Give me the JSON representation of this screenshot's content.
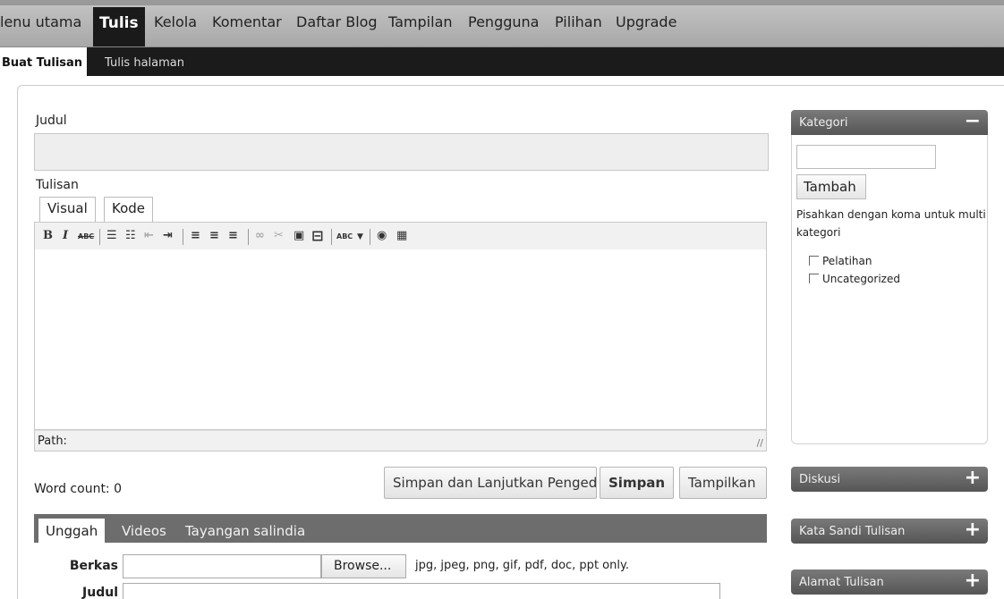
{
  "topnav": {
    "items": [
      {
        "label": "lenu utama"
      },
      {
        "label": "Tulis",
        "active": true
      },
      {
        "label": "Kelola"
      },
      {
        "label": "Komentar"
      },
      {
        "label": "Daftar Blog"
      },
      {
        "label": "Tampilan"
      },
      {
        "label": "Pengguna"
      },
      {
        "label": "Pilihan"
      },
      {
        "label": "Upgrade"
      }
    ]
  },
  "subnav": {
    "active": "Buat Tulisan",
    "other": "Tulis halaman"
  },
  "post": {
    "title_label": "Judul",
    "title_value": "",
    "content_label": "Tulisan",
    "tab_visual": "Visual",
    "tab_code": "Kode",
    "path_label": "Path:",
    "word_count": "Word count: 0"
  },
  "toolbar": {
    "bold": "B",
    "italic": "I",
    "strike": "ABC",
    "spell": "ABC"
  },
  "buttons": {
    "save_continue": "Simpan dan Lanjutkan Penged",
    "save": "Simpan",
    "preview": "Tampilkan"
  },
  "upload": {
    "tabs": [
      "Unggah",
      "Videos",
      "Tayangan salindia"
    ],
    "file_label": "Berkas",
    "browse": "Browse...",
    "filetypes": "jpg, jpeg, png, gif, pdf, doc, ppt only.",
    "title_label": "Judul"
  },
  "sidebar": {
    "category": {
      "title": "Kategori",
      "toggle": "−",
      "add_button": "Tambah",
      "hint": "Pisahkan dengan koma untuk multi kategori",
      "items": [
        "Pelatihan",
        "Uncategorized"
      ]
    },
    "discussion": {
      "title": "Diskusi",
      "toggle": "+"
    },
    "password": {
      "title": "Kata Sandi Tulisan",
      "toggle": "+"
    },
    "slug": {
      "title": "Alamat Tulisan",
      "toggle": "+"
    }
  },
  "colors": {
    "nav_bg": "#b4b4b4",
    "subnav_bg": "#1b1b1b",
    "sidebar_header": "#666666",
    "upload_bar": "#6d6d6d"
  }
}
